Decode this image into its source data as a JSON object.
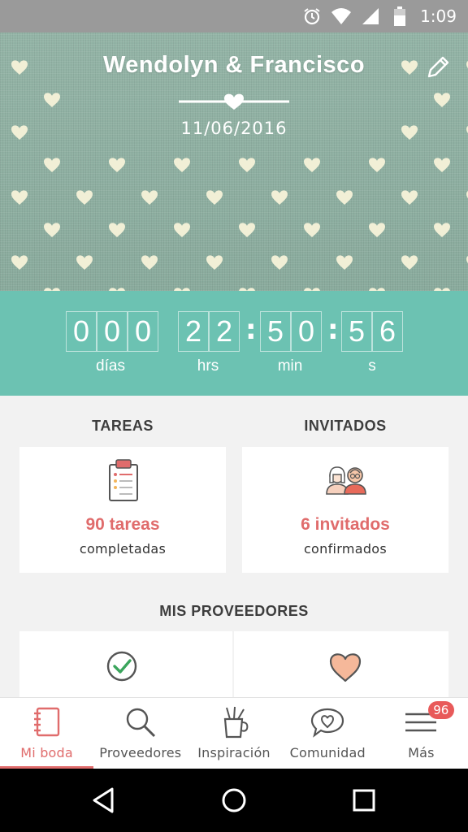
{
  "status_bar": {
    "time": "1:09",
    "icons": [
      "alarm-icon",
      "wifi-icon",
      "signal-icon",
      "battery-icon"
    ]
  },
  "header": {
    "couple_names": "Wendolyn & Francisco",
    "wedding_date": "11/06/2016",
    "edit_icon": "pencil-icon"
  },
  "countdown": {
    "days": [
      "0",
      "0",
      "0"
    ],
    "hours": [
      "2",
      "2"
    ],
    "minutes": [
      "5",
      "0"
    ],
    "seconds": [
      "5",
      "6"
    ],
    "labels": {
      "days": "días",
      "hours": "hrs",
      "minutes": "min",
      "seconds": "s"
    }
  },
  "tasks": {
    "title": "TAREAS",
    "value": "90 tareas",
    "subtitle": "completadas",
    "icon": "clipboard-icon"
  },
  "guests": {
    "title": "INVITADOS",
    "value": "6 invitados",
    "subtitle": "confirmados",
    "icon": "couple-avatars-icon"
  },
  "providers": {
    "title": "MIS PROVEEDORES",
    "icons": [
      "checkmark-circle-icon",
      "heart-icon"
    ]
  },
  "bottom_nav": {
    "items": [
      {
        "label": "Mi boda",
        "icon": "notebook-icon",
        "active": true
      },
      {
        "label": "Proveedores",
        "icon": "search-icon",
        "active": false
      },
      {
        "label": "Inspiración",
        "icon": "pencil-cup-icon",
        "active": false
      },
      {
        "label": "Comunidad",
        "icon": "heart-chat-icon",
        "active": false
      },
      {
        "label": "Más",
        "icon": "menu-icon",
        "active": false,
        "badge": "96"
      }
    ]
  },
  "android_nav": {
    "icons": [
      "back-icon",
      "home-icon",
      "recents-icon"
    ]
  },
  "colors": {
    "accent": "#e06c6c",
    "countdown_bg": "#6cc2b2",
    "header_bg": "#8fb0a2",
    "heart_cream": "#f1efd6",
    "provider_heart": "#f5b89a",
    "check_green": "#3aa55c"
  }
}
